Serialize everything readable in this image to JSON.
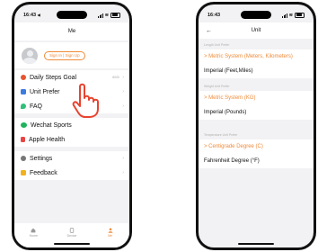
{
  "left_phone": {
    "status": {
      "time": "16:43",
      "extra": "◀"
    },
    "title": "Me",
    "sign_in_label": "Sign In | Sign Up",
    "menu": [
      {
        "label": "Daily Steps Goal",
        "value": "8000",
        "icon": "steps-icon",
        "color": "#e8542f"
      },
      {
        "label": "Unit Prefer",
        "value": "",
        "icon": "ruler-icon",
        "color": "#3d7be0"
      },
      {
        "label": "FAQ",
        "value": "",
        "icon": "faq-icon",
        "color": "#2fc07a"
      },
      {
        "label": "Wechat Sports",
        "value": "",
        "icon": "wechat-icon",
        "color": "#1fb35c"
      },
      {
        "label": "Apple Health",
        "value": "",
        "icon": "health-icon",
        "color": "#e84545"
      },
      {
        "label": "Settings",
        "value": "",
        "icon": "gear-icon",
        "color": "#777777"
      },
      {
        "label": "Feedback",
        "value": "",
        "icon": "feedback-icon",
        "color": "#f2b21f"
      }
    ],
    "tabs": [
      {
        "label": "Home",
        "icon": "home-icon",
        "active": false
      },
      {
        "label": "Device",
        "icon": "device-icon",
        "active": false
      },
      {
        "label": "Me",
        "icon": "user-icon",
        "active": true
      }
    ]
  },
  "right_phone": {
    "status": {
      "time": "16:43"
    },
    "title": "Unit",
    "sections": [
      {
        "header": "Length Unit Prefer",
        "options": [
          "> Metric System (Meters, Kilometers)",
          "Imperial (Feet,Miles)"
        ],
        "active": 0
      },
      {
        "header": "Weight Unit Prefer",
        "options": [
          "> Metric System (KG)",
          "Imperial (Pounds)"
        ],
        "active": 0
      },
      {
        "header": "Temperature Unit Prefer",
        "options": [
          "> Centigrade Degree (C)",
          "Fahrenheit Degree (°F)"
        ],
        "active": 0
      }
    ]
  },
  "colors": {
    "accent": "#f08b39",
    "background": "#f2f2f4"
  }
}
